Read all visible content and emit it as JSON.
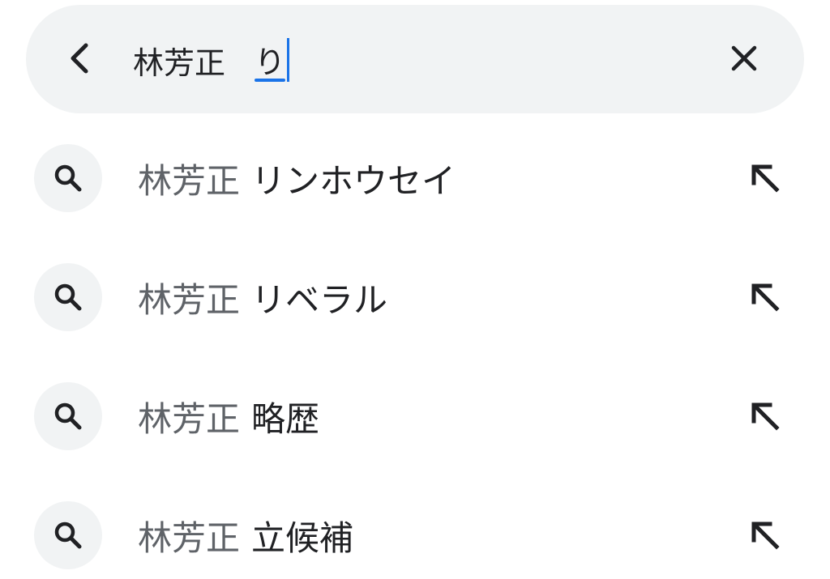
{
  "search": {
    "query_committed": "林芳正",
    "query_composing": "り"
  },
  "icons": {
    "back": "back-arrow-icon",
    "clear": "close-icon",
    "suggestion": "search-icon",
    "fill": "arrow-up-left-icon"
  },
  "colors": {
    "accent": "#1a73e8",
    "surface": "#f1f3f4",
    "text_primary": "#202124",
    "text_secondary": "#5f6368"
  },
  "suggestions": [
    {
      "prefix": "林芳正",
      "suffix": "リンホウセイ"
    },
    {
      "prefix": "林芳正",
      "suffix": "リベラル"
    },
    {
      "prefix": "林芳正",
      "suffix": "略歴"
    },
    {
      "prefix": "林芳正",
      "suffix": "立候補"
    }
  ]
}
